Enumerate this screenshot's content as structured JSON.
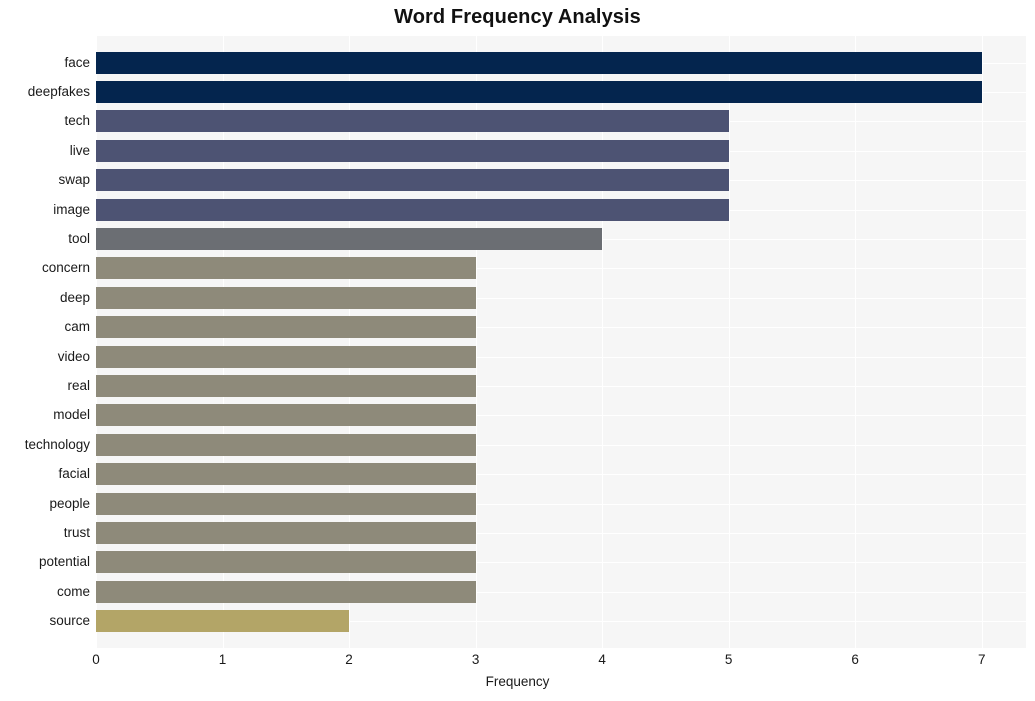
{
  "chart_data": {
    "type": "bar",
    "orientation": "horizontal",
    "title": "Word Frequency Analysis",
    "xlabel": "Frequency",
    "ylabel": "",
    "xlim": [
      0,
      7.35
    ],
    "xticks": [
      0,
      1,
      2,
      3,
      4,
      5,
      6,
      7
    ],
    "xtick_labels": [
      "0",
      "1",
      "2",
      "3",
      "4",
      "5",
      "6",
      "7"
    ],
    "grid": true,
    "legend": "none",
    "categories": [
      "face",
      "deepfakes",
      "tech",
      "live",
      "swap",
      "image",
      "tool",
      "concern",
      "deep",
      "cam",
      "video",
      "real",
      "model",
      "technology",
      "facial",
      "people",
      "trust",
      "potential",
      "come",
      "source"
    ],
    "values": [
      7,
      7,
      5,
      5,
      5,
      5,
      4,
      3,
      3,
      3,
      3,
      3,
      3,
      3,
      3,
      3,
      3,
      3,
      3,
      2
    ],
    "bar_colors": [
      "#04254e",
      "#04254e",
      "#4d5373",
      "#4d5373",
      "#4d5373",
      "#4d5373",
      "#6b6e73",
      "#8e8a7a",
      "#8e8a7a",
      "#8e8a7a",
      "#8e8a7a",
      "#8e8a7a",
      "#8e8a7a",
      "#8e8a7a",
      "#8e8a7a",
      "#8e8a7a",
      "#8e8a7a",
      "#8e8a7a",
      "#8e8a7a",
      "#b3a567"
    ],
    "plot_background": "#f6f6f6",
    "grid_color": "#ffffff",
    "figure_background": "#ffffff"
  }
}
